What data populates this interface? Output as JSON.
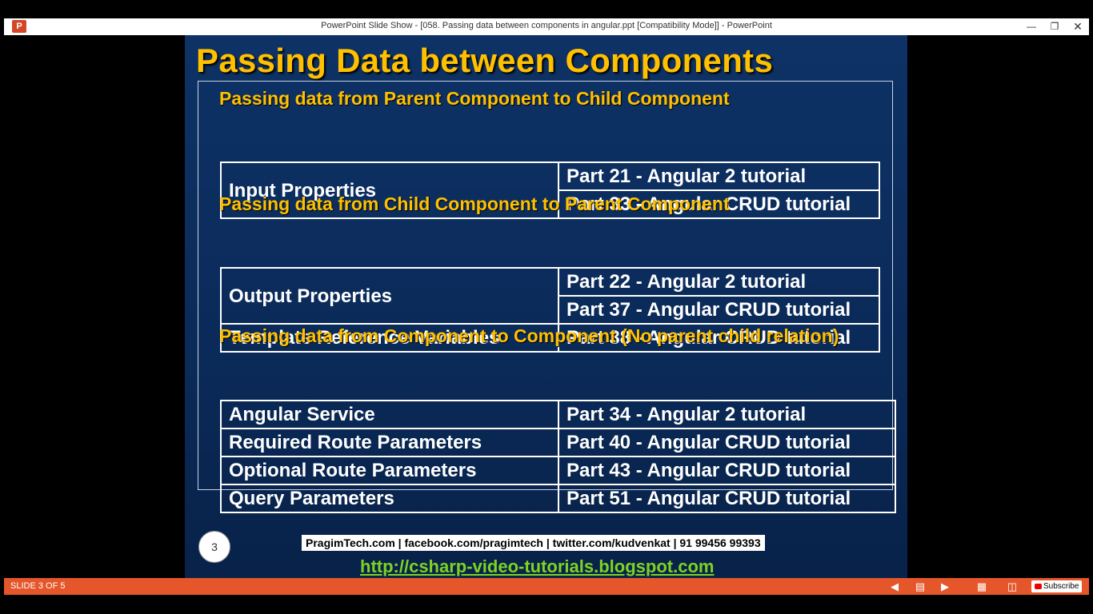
{
  "window": {
    "title": "PowerPoint Slide Show - [058. Passing data between components in angular.ppt [Compatibility Mode]] - PowerPoint",
    "app_icon": "P"
  },
  "slide": {
    "title": "Passing Data between Components",
    "sections": [
      {
        "heading": "Passing data from Parent Component to Child Component",
        "rows": [
          {
            "left": "Input Properties",
            "right": [
              "Part 21 - Angular 2 tutorial",
              "Part 33 - Angular CRUD tutorial"
            ]
          }
        ]
      },
      {
        "heading": "Passing data from Child Component to Parent Component",
        "rows": [
          {
            "left": "Output Properties",
            "right": [
              "Part 22 - Angular 2 tutorial",
              "Part 37 - Angular CRUD tutorial"
            ]
          },
          {
            "left": "Template Reference Variables",
            "right": [
              "Part 38 - Angular CRUD tutorial"
            ]
          }
        ]
      },
      {
        "heading": "Passing data from Component to Component (No parent child relation)",
        "rows": [
          {
            "left": "Angular Service",
            "right": [
              "Part 34 - Angular 2 tutorial"
            ]
          },
          {
            "left": "Required Route Parameters",
            "right": [
              "Part 40 - Angular CRUD tutorial"
            ]
          },
          {
            "left": "Optional Route Parameters",
            "right": [
              "Part 43 - Angular CRUD tutorial"
            ]
          },
          {
            "left": "Query Parameters",
            "right": [
              "Part 51 - Angular CRUD tutorial"
            ]
          }
        ]
      }
    ],
    "slide_number": "3",
    "footer_contact": "PragimTech.com | facebook.com/pragimtech | twitter.com/kudvenkat | 91 99456 99393",
    "footer_url": "http://csharp-video-tutorials.blogspot.com"
  },
  "statusbar": {
    "slide_counter": "SLIDE 3 OF 5",
    "subscribe_label": "Subscribe",
    "icons": [
      "previous-icon",
      "notes-icon",
      "next-icon",
      "reading-view-icon",
      "slide-sorter-icon"
    ]
  },
  "colors": {
    "heading": "#ffc000",
    "slide_bg": "#0e3266",
    "statusbar": "#e5562a",
    "url": "#7ed321"
  }
}
